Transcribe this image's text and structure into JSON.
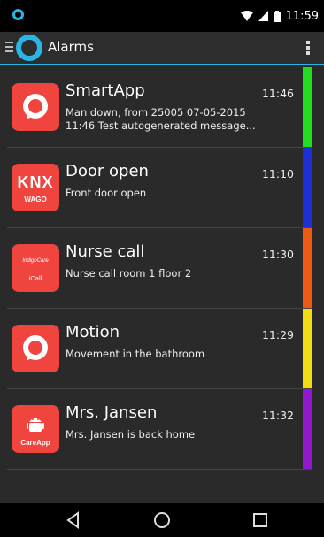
{
  "status_bar": {
    "time": "11:59"
  },
  "action_bar": {
    "title": "Alarms"
  },
  "alarms": [
    {
      "title": "SmartApp",
      "lines": [
        "Man down, from 25005 07-05-2015",
        "11:46 Test autogenerated message..."
      ],
      "time": "11:46",
      "color": "#22dd22",
      "icon": "smartapp-bubble-icon",
      "icon_text": []
    },
    {
      "title": "Door open",
      "lines": [
        "Front door open"
      ],
      "time": "11:10",
      "color": "#1e2fd6",
      "icon": "knx-wago-icon",
      "icon_text": [
        "KNX",
        "WAGO"
      ]
    },
    {
      "title": "Nurse call",
      "lines": [
        "Nurse call room 1 floor 2"
      ],
      "time": "11:30",
      "color": "#ee5a12",
      "icon": "indigocare-icall-icon",
      "icon_text": [
        "IndigoCare",
        "iCall"
      ]
    },
    {
      "title": "Motion",
      "lines": [
        "Movement in the bathroom"
      ],
      "time": "11:29",
      "color": "#f3dc13",
      "icon": "smartapp-bubble-icon",
      "icon_text": []
    },
    {
      "title": "Mrs. Jansen",
      "lines": [
        "Mrs. Jansen is back home"
      ],
      "time": "11:32",
      "color": "#9019cf",
      "icon": "careapp-android-icon",
      "icon_text": [
        "CareApp"
      ]
    }
  ]
}
